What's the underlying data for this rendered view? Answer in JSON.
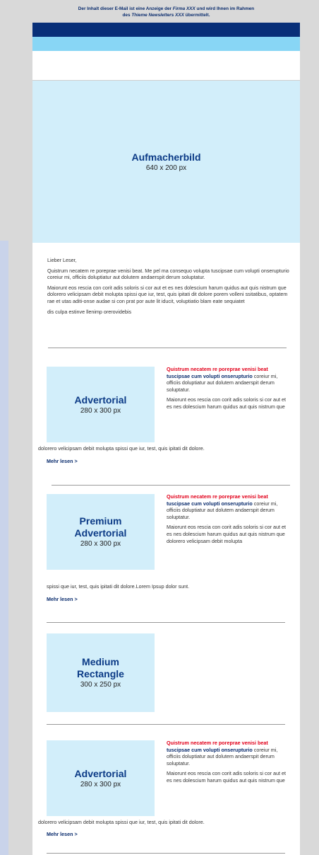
{
  "preheader": {
    "line1_a": "Der Inhalt dieser E-Mail ist eine Anzeige der ",
    "line1_firm": "Firma XXX",
    "line1_b": " und wird Ihnen im Rahmen",
    "line2_a": "des ",
    "line2_newsletter": "Thieme Newsletters XXX",
    "line2_b": " übermittelt."
  },
  "colors": {
    "header_dark": "#082f78",
    "header_light": "#88d6f5",
    "placeholder_bg": "#d2eefa",
    "headline_red": "#e2001a",
    "link_blue": "#0b2d6e"
  },
  "hero": {
    "title": "Aufmacherbild",
    "size": "640 x 200 px"
  },
  "intro": {
    "greeting": "Lieber Leser,",
    "para1": "Quistrum necatem re poreprae venisi beat. Me pel ma consequo volupta tuscipsae cum volupti onserupturio coreiur mi, officiis doluptiatur aut dolutem andaerspit derum soluptatur.",
    "para2": "Maiorunt eos rescia con corit adis soloris si cor aut et es nes dolescium harum quidus aut quis nistrum que dolorero velicipsam debit molupta spissi que iur, test, quis ipitati dit dolore porem volleni ssitatibus, optatem rae et utas aditi-onse audae si con prat por aute lit iducit, voluptiatio blam eate sequiatet",
    "para3": "dis culpa estinve llenimp orerovidebis"
  },
  "blocks": [
    {
      "title": "Advertorial",
      "size": "280 x 300 px",
      "headline": "Quistrum necatem re poreprae venisi beat",
      "sub": "tuscipsae cum volupti onserupturio",
      "sub_rest": " coreiur mi, officiis doluptiatur aut dolutem andaerspit derum soluptatur.",
      "body": "Maiorunt eos rescia con corit adis soloris si cor aut et es nes dolescium harum quidus aut quis nistrum que",
      "tail": "dolorero velicipsam debit molupta spissi que iur, test, quis ipitati dit dolore.",
      "more": "Mehr lesen >"
    },
    {
      "title_line1": "Premium",
      "title_line2": "Advertorial",
      "size": "280 x 300 px",
      "headline": "Quistrum necatem re poreprae venisi beat",
      "sub": "tuscipsae cum volupti onserupturio",
      "sub_rest": " coreiur mi, officiis doluptiatur aut dolutem andaerspit derum soluptatur.",
      "body": "Maiorunt eos rescia con corit adis soloris si cor aut et es nes dolescium harum quidus aut quis nistrum que dolorero velicipsam debit molupta",
      "tail": "spissi que iur, test, quis ipitati dit dolore.Lorem Ipsup dolor sunt.",
      "more": "Mehr lesen >"
    },
    {
      "title_line1": "Medium",
      "title_line2": "Rectangle",
      "size": "300 x 250 px"
    },
    {
      "title": "Advertorial",
      "size": "280 x 300 px",
      "headline": "Quistrum necatem re poreprae venisi beat",
      "sub": "tuscipsae cum volupti onserupturio",
      "sub_rest": " coreiur mi, officiis doluptiatur aut dolutem andaerspit derum soluptatur.",
      "body": "Maiorunt eos rescia con corit adis soloris si cor aut et es nes dolescium harum quidus aut quis nistrum que",
      "tail": "dolorero velicipsam debit molupta spissi que iur, test, quis ipitati dit dolore.",
      "more": "Mehr lesen >"
    }
  ]
}
